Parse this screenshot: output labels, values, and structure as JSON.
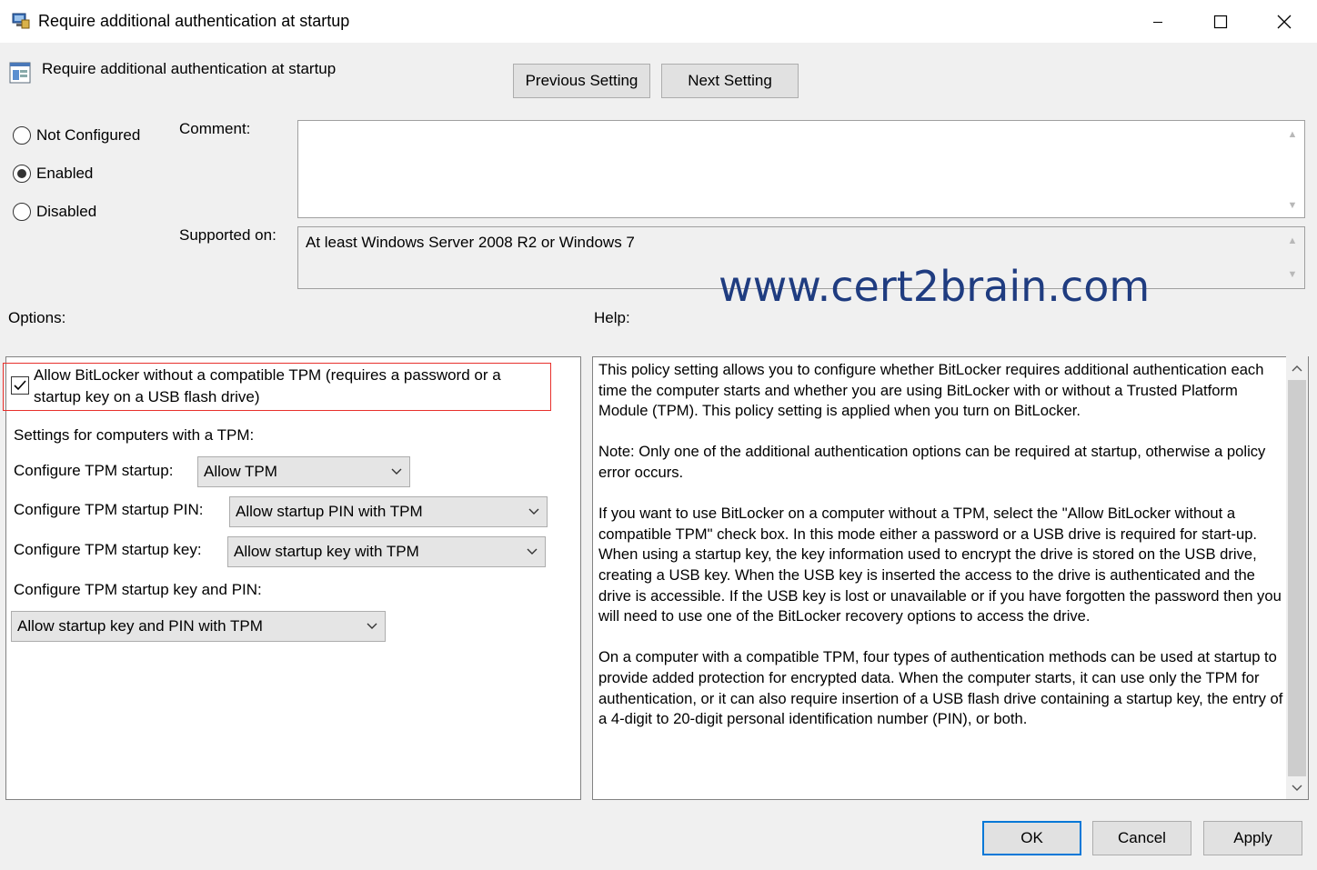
{
  "window": {
    "title": "Require additional authentication at startup"
  },
  "header": {
    "title": "Require additional authentication at startup",
    "previous_label": "Previous Setting",
    "next_label": "Next Setting"
  },
  "state": {
    "options": [
      {
        "label": "Not Configured",
        "checked": false
      },
      {
        "label": "Enabled",
        "checked": true
      },
      {
        "label": "Disabled",
        "checked": false
      }
    ]
  },
  "comment": {
    "label": "Comment:",
    "value": ""
  },
  "supported": {
    "label": "Supported on:",
    "value": "At least Windows Server 2008 R2 or Windows 7"
  },
  "watermark": "www.cert2brain.com",
  "options_panel": {
    "label": "Options:",
    "allow_no_tpm_line1": "Allow BitLocker without a compatible TPM (requires a password or a",
    "allow_no_tpm_line2": "startup key on a USB flash drive)",
    "allow_no_tpm_checked": true,
    "tpm_section_label": "Settings for computers with a TPM:",
    "tpm_startup_label": "Configure TPM startup:",
    "tpm_startup_value": "Allow TPM",
    "tpm_pin_label": "Configure TPM startup PIN:",
    "tpm_pin_value": "Allow startup PIN with TPM",
    "tpm_key_label": "Configure TPM startup key:",
    "tpm_key_value": "Allow startup key with TPM",
    "tpm_key_pin_label": "Configure TPM startup key and PIN:",
    "tpm_key_pin_value": "Allow startup key and PIN with TPM"
  },
  "help_panel": {
    "label": "Help:",
    "paragraphs": [
      "This policy setting allows you to configure whether BitLocker requires additional authentication each time the computer starts and whether you are using BitLocker with or without a Trusted Platform Module (TPM). This policy setting is applied when you turn on BitLocker.",
      "Note: Only one of the additional authentication options can be required at startup, otherwise a policy error occurs.",
      "If you want to use BitLocker on a computer without a TPM, select the \"Allow BitLocker without a compatible TPM\" check box. In this mode either a password or a USB drive is required for start-up. When using a startup key, the key information used to encrypt the drive is stored on the USB drive, creating a USB key. When the USB key is inserted the access to the drive is authenticated and the drive is accessible. If the USB key is lost or unavailable or if you have forgotten the password then you will need to use one of the BitLocker recovery options to access the drive.",
      "On a computer with a compatible TPM, four types of authentication methods can be used at startup to provide added protection for encrypted data. When the computer starts, it can use only the TPM for authentication, or it can also require insertion of a USB flash drive containing a startup key, the entry of a 4-digit to 20-digit personal identification number (PIN), or both."
    ]
  },
  "footer": {
    "ok_label": "OK",
    "cancel_label": "Cancel",
    "apply_label": "Apply"
  }
}
